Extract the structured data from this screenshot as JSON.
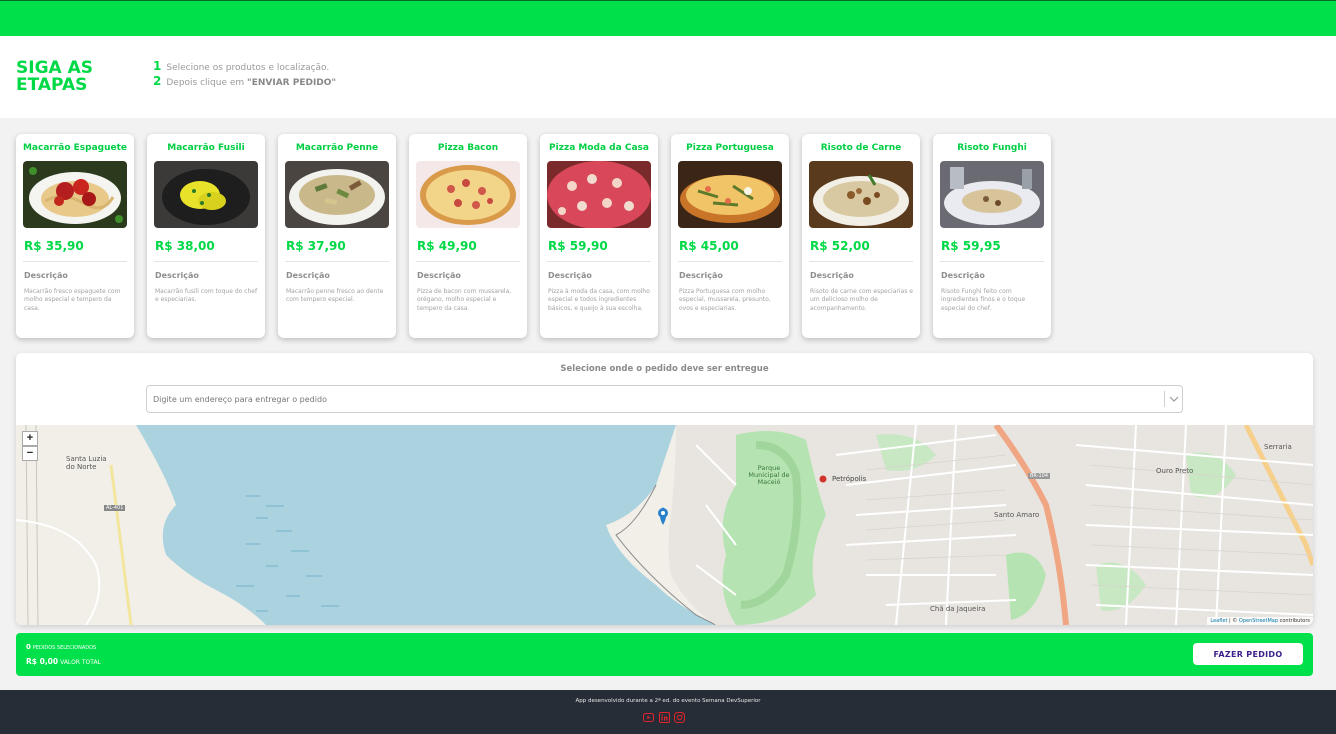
{
  "steps": {
    "title": "SIGA AS ETAPAS",
    "items": [
      {
        "num": "1",
        "text": "Selecione os produtos e localização."
      },
      {
        "num": "2",
        "text": "Depois clique em ",
        "bold": "\"ENVIAR PEDIDO\""
      }
    ]
  },
  "products": [
    {
      "name": "Macarrão Espaguete",
      "price": "R$ 35,90",
      "desc_label": "Descrição",
      "desc": "Macarrão fresco espaguete com molho especial e tempero da casa."
    },
    {
      "name": "Macarrão Fusili",
      "price": "R$ 38,00",
      "desc_label": "Descrição",
      "desc": "Macarrão fusili com toque do chef e especiarias."
    },
    {
      "name": "Macarrão Penne",
      "price": "R$ 37,90",
      "desc_label": "Descrição",
      "desc": "Macarrão penne fresco ao dente com tempero especial."
    },
    {
      "name": "Pizza Bacon",
      "price": "R$ 49,90",
      "desc_label": "Descrição",
      "desc": "Pizza de bacon com mussarela, orégano, molho especial e tempero da casa."
    },
    {
      "name": "Pizza Moda da Casa",
      "price": "R$ 59,90",
      "desc_label": "Descrição",
      "desc": "Pizza à moda da casa, com molho especial e todos ingredientes básicos, e queijo à sua escolha."
    },
    {
      "name": "Pizza Portuguesa",
      "price": "R$ 45,00",
      "desc_label": "Descrição",
      "desc": "Pizza Portuguesa com molho especial, mussarela, presunto, ovos e especiarias."
    },
    {
      "name": "Risoto de Carne",
      "price": "R$ 52,00",
      "desc_label": "Descrição",
      "desc": "Risoto de carne com especiarias e um delicioso molho de acompanhamento."
    },
    {
      "name": "Risoto Funghi",
      "price": "R$ 59,95",
      "desc_label": "Descrição",
      "desc": "Risoto Funghi feito com ingredientes finos e o toque especial do chef."
    }
  ],
  "location": {
    "title": "Selecione onde o pedido deve ser entregue",
    "placeholder": "Digite um endereço para entregar o pedido"
  },
  "map": {
    "zoom_in": "+",
    "zoom_out": "−",
    "labels": {
      "santa_luzia": "Santa Luzia do Norte",
      "parque": "Parque Municipal de Maceió",
      "petropolis": "Petrópolis",
      "ouro_preto": "Ouro Preto",
      "santo_amaro": "Santo Amaro",
      "cha_jaqueira": "Chã da Jaqueira",
      "serraria": "Serraria",
      "al401": "AL-401",
      "br104": "BR-104"
    },
    "attribution_leaflet": "Leaflet",
    "attribution_sep": " | © ",
    "attribution_osm": "OpenStreetMap",
    "attribution_rest": " contributors"
  },
  "order": {
    "count": "0",
    "count_label": "PEDIDOS SELECIONADOS",
    "total": "R$ 0,00",
    "total_label": "VALOR TOTAL",
    "button": "FAZER PEDIDO"
  },
  "footer": {
    "text": "App desenvolvido durante a 2ª ed. do evento Semana DevSuperior"
  },
  "colors": {
    "accent": "#00e04b",
    "footer_bg": "#262d36",
    "social": "#e0242b"
  },
  "icons": {
    "youtube": "youtube-icon",
    "linkedin": "linkedin-icon",
    "instagram": "instagram-icon"
  }
}
